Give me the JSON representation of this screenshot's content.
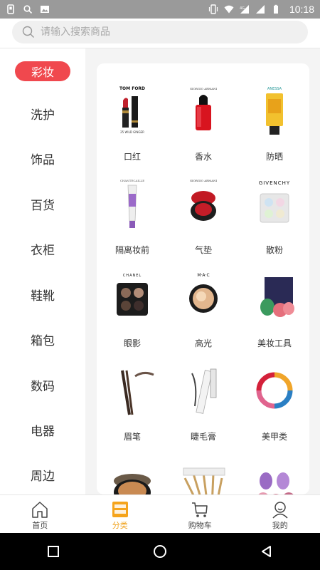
{
  "status_bar": {
    "time": "10:18"
  },
  "search": {
    "placeholder": "请输入搜索商品"
  },
  "sidebar": {
    "items": [
      {
        "label": "彩妆",
        "active": true
      },
      {
        "label": "洗护"
      },
      {
        "label": "饰品"
      },
      {
        "label": "百货"
      },
      {
        "label": "衣柜"
      },
      {
        "label": "鞋靴"
      },
      {
        "label": "箱包"
      },
      {
        "label": "数码"
      },
      {
        "label": "电器"
      },
      {
        "label": "周边"
      }
    ]
  },
  "grid": {
    "items": [
      {
        "label": "口红",
        "brand": "TOM FORD"
      },
      {
        "label": "香水",
        "brand": "GIORGIO ARMANI"
      },
      {
        "label": "防晒",
        "brand": "ANESSA"
      },
      {
        "label": "隔离妆前",
        "brand": "CHANTECAILLE"
      },
      {
        "label": "气垫",
        "brand": "GIORGIO ARMANI"
      },
      {
        "label": "散粉",
        "brand": "GIVENCHY"
      },
      {
        "label": "眼影",
        "brand": "CHANEL"
      },
      {
        "label": "高光",
        "brand": "M·A·C"
      },
      {
        "label": "美妆工具",
        "brand": ""
      },
      {
        "label": "眉笔",
        "brand": ""
      },
      {
        "label": "睫毛膏",
        "brand": ""
      },
      {
        "label": "美甲类",
        "brand": ""
      },
      {
        "label": "",
        "brand": ""
      },
      {
        "label": "",
        "brand": ""
      },
      {
        "label": "",
        "brand": ""
      }
    ]
  },
  "tabbar": {
    "tabs": [
      {
        "label": "首页",
        "icon": "home-icon"
      },
      {
        "label": "分类",
        "icon": "category-icon",
        "active": true
      },
      {
        "label": "购物车",
        "icon": "cart-icon"
      },
      {
        "label": "我的",
        "icon": "profile-icon"
      }
    ]
  },
  "colors": {
    "accent_red": "#f0484e",
    "active_tab": "#f0a21c"
  }
}
